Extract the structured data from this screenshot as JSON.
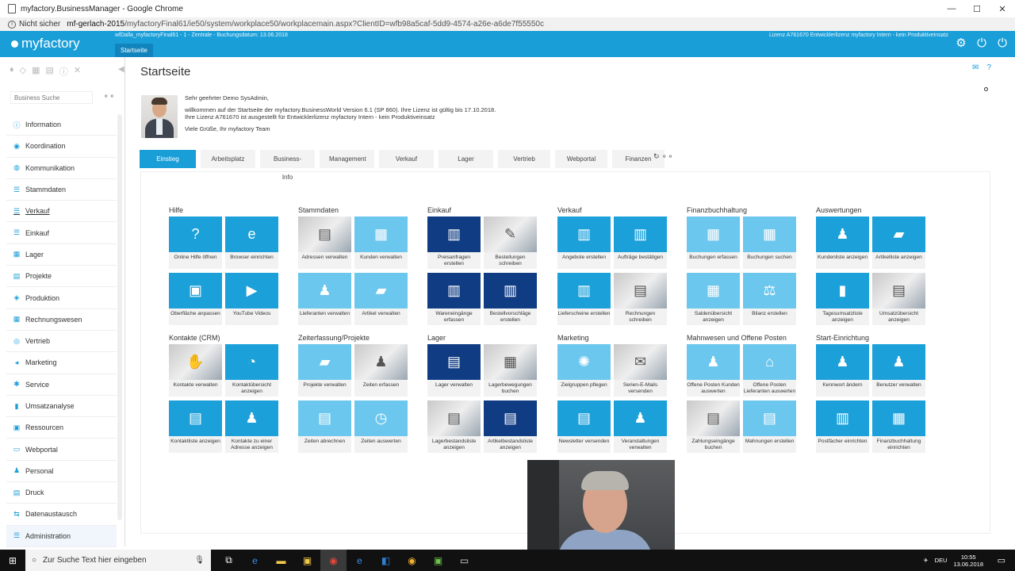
{
  "browser": {
    "title": "myfactory.BusinessManager - Google Chrome",
    "security": "Nicht sicher",
    "url_host": "mf-gerlach-2015",
    "url_path": "/myfactoryFinal61/ie50/system/workplace50/workplacemain.aspx?ClientID=wfb98a5caf-5dd9-4574-a26e-a6de7f55550c"
  },
  "header": {
    "logo": "myfactory",
    "workspace_info": "wfDalla_myfactoryFinal61 - 1 - Zentrale - Buchungsdatum: 13.06.2018",
    "workspace_tab": "Startseite",
    "license_info": "Lizenz A761670 Entwicklerlizenz myfactory Intern - kein Produktiveinsatz"
  },
  "sidebar": {
    "search_placeholder": "Business Suche",
    "items": [
      {
        "label": "Information"
      },
      {
        "label": "Koordination"
      },
      {
        "label": "Kommunikation"
      },
      {
        "label": "Stammdaten"
      },
      {
        "label": "Verkauf"
      },
      {
        "label": "Einkauf"
      },
      {
        "label": "Lager"
      },
      {
        "label": "Projekte"
      },
      {
        "label": "Produktion"
      },
      {
        "label": "Rechnungswesen"
      },
      {
        "label": "Vertrieb"
      },
      {
        "label": "Marketing"
      },
      {
        "label": "Service"
      },
      {
        "label": "Umsatzanalyse"
      },
      {
        "label": "Ressourcen"
      },
      {
        "label": "Webportal"
      },
      {
        "label": "Personal"
      },
      {
        "label": "Druck"
      },
      {
        "label": "Datenaustausch"
      },
      {
        "label": "Administration"
      }
    ]
  },
  "main": {
    "title": "Startseite",
    "welcome": {
      "greeting": "Sehr geehrter Demo SysAdmin,",
      "line1": "willkommen auf der Startseite der myfactory.BusinessWorld Version 6.1 (SP 860). Ihre Lizenz ist gültig bis 17.10.2018.",
      "line2": "Ihre Lizenz A761670 ist ausgestellt für Entwicklerlizenz myfactory Intern - kein Produktiveinsatz",
      "closing": "Viele Grüße, Ihr myfactory Team"
    },
    "tabs": [
      "Einstieg",
      "Arbeitsplatz",
      "Business-Info",
      "Management",
      "Verkauf",
      "Lager",
      "Vertrieb",
      "Webportal",
      "Finanzen"
    ],
    "groups": [
      {
        "title": "Hilfe",
        "tiles": [
          {
            "label": "Online Hilfe öffnen",
            "style": "mid",
            "icon": "?"
          },
          {
            "label": "Browser einrichten",
            "style": "mid",
            "icon": "e"
          },
          {
            "label": "Oberfläche anpassen",
            "style": "mid",
            "icon": "▣"
          },
          {
            "label": "YouTube Videos",
            "style": "mid",
            "icon": "▶"
          }
        ]
      },
      {
        "title": "Stammdaten",
        "tiles": [
          {
            "label": "Adressen verwalten",
            "style": "photo",
            "icon": "▤"
          },
          {
            "label": "Kunden verwalten",
            "style": "light",
            "icon": "▦"
          },
          {
            "label": "Lieferanten verwalten",
            "style": "light",
            "icon": "♟"
          },
          {
            "label": "Artikel verwalten",
            "style": "light",
            "icon": "▰"
          }
        ]
      },
      {
        "title": "Einkauf",
        "tiles": [
          {
            "label": "Preisanfragen erstellen",
            "style": "dark",
            "icon": "▥"
          },
          {
            "label": "Bestellungen schreiben",
            "style": "photo",
            "icon": "✎"
          },
          {
            "label": "Wareneingänge erfassen",
            "style": "dark",
            "icon": "▥"
          },
          {
            "label": "Bestellvorschläge erstellen",
            "style": "dark",
            "icon": "▥"
          }
        ]
      },
      {
        "title": "Verkauf",
        "tiles": [
          {
            "label": "Angebote erstellen",
            "style": "mid",
            "icon": "▥"
          },
          {
            "label": "Aufträge bestätigen",
            "style": "mid",
            "icon": "▥"
          },
          {
            "label": "Lieferscheine erstellen",
            "style": "mid",
            "icon": "▥"
          },
          {
            "label": "Rechnungen schreiben",
            "style": "photo",
            "icon": "▤"
          }
        ]
      },
      {
        "title": "Finanzbuchhaltung",
        "tiles": [
          {
            "label": "Buchungen erfassen",
            "style": "light",
            "icon": "▦"
          },
          {
            "label": "Buchungen suchen",
            "style": "light",
            "icon": "▦"
          },
          {
            "label": "Saldenübersicht anzeigen",
            "style": "light",
            "icon": "▦"
          },
          {
            "label": "Bilanz erstellen",
            "style": "light",
            "icon": "⚖"
          }
        ]
      },
      {
        "title": "Auswertungen",
        "tiles": [
          {
            "label": "Kundenliste anzeigen",
            "style": "mid",
            "icon": "♟"
          },
          {
            "label": "Artikelliste anzeigen",
            "style": "mid",
            "icon": "▰"
          },
          {
            "label": "Tagesumsatzliste anzeigen",
            "style": "mid",
            "icon": "▮"
          },
          {
            "label": "Umsatzübersicht anzeigen",
            "style": "photo",
            "icon": "▤"
          }
        ]
      },
      {
        "title": "Kontakte (CRM)",
        "tiles": [
          {
            "label": "Kontakte verwalten",
            "style": "photo",
            "icon": "✋"
          },
          {
            "label": "Kontaktübersicht anzeigen",
            "style": "mid",
            "icon": "◔"
          },
          {
            "label": "Kontaktliste anzeigen",
            "style": "mid",
            "icon": "▤"
          },
          {
            "label": "Kontakte zu einer Adresse anzeigen",
            "style": "mid",
            "icon": "♟"
          }
        ]
      },
      {
        "title": "Zeiterfassung/Projekte",
        "tiles": [
          {
            "label": "Projekte verwalten",
            "style": "light",
            "icon": "▰"
          },
          {
            "label": "Zeiten erfassen",
            "style": "photo",
            "icon": "♟"
          },
          {
            "label": "Zeiten abrechnen",
            "style": "light",
            "icon": "▤"
          },
          {
            "label": "Zeiten auswerten",
            "style": "light",
            "icon": "◷"
          }
        ]
      },
      {
        "title": "Lager",
        "tiles": [
          {
            "label": "Lager verwalten",
            "style": "dark",
            "icon": "▤"
          },
          {
            "label": "Lagerbewegungen buchen",
            "style": "photo",
            "icon": "▦"
          },
          {
            "label": "Lagerbestandsliste anzeigen",
            "style": "photo",
            "icon": "▤"
          },
          {
            "label": "Artikelbestandsliste anzeigen",
            "style": "dark",
            "icon": "▤"
          }
        ]
      },
      {
        "title": "Marketing",
        "tiles": [
          {
            "label": "Zielgruppen pflegen",
            "style": "light",
            "icon": "✺"
          },
          {
            "label": "Serien-E-Mails versenden",
            "style": "photo",
            "icon": "✉"
          },
          {
            "label": "Newsletter versenden",
            "style": "mid",
            "icon": "▤"
          },
          {
            "label": "Veranstaltungen verwalten",
            "style": "mid",
            "icon": "♟"
          }
        ]
      },
      {
        "title": "Mahnwesen und Offene Posten",
        "tiles": [
          {
            "label": "Offene Posten Kunden auswerten",
            "style": "light",
            "icon": "♟"
          },
          {
            "label": "Offene Posten Lieferanten auswerten",
            "style": "light",
            "icon": "⌂"
          },
          {
            "label": "Zahlungseingänge buchen",
            "style": "photo",
            "icon": "▤"
          },
          {
            "label": "Mahnungen erstellen",
            "style": "light",
            "icon": "▤"
          }
        ]
      },
      {
        "title": "Start-Einrichtung",
        "tiles": [
          {
            "label": "Kennwort ändern",
            "style": "mid",
            "icon": "♟"
          },
          {
            "label": "Benutzer verwalten",
            "style": "mid",
            "icon": "♟"
          },
          {
            "label": "Postfächer einrichten",
            "style": "mid",
            "icon": "▥"
          },
          {
            "label": "Finanzbuchhaltung einrichten",
            "style": "mid",
            "icon": "▦"
          }
        ]
      }
    ]
  },
  "taskbar": {
    "search_placeholder": "Zur Suche Text hier eingeben",
    "language": "DEU",
    "time": "10:55",
    "date": "13.06.2018"
  }
}
